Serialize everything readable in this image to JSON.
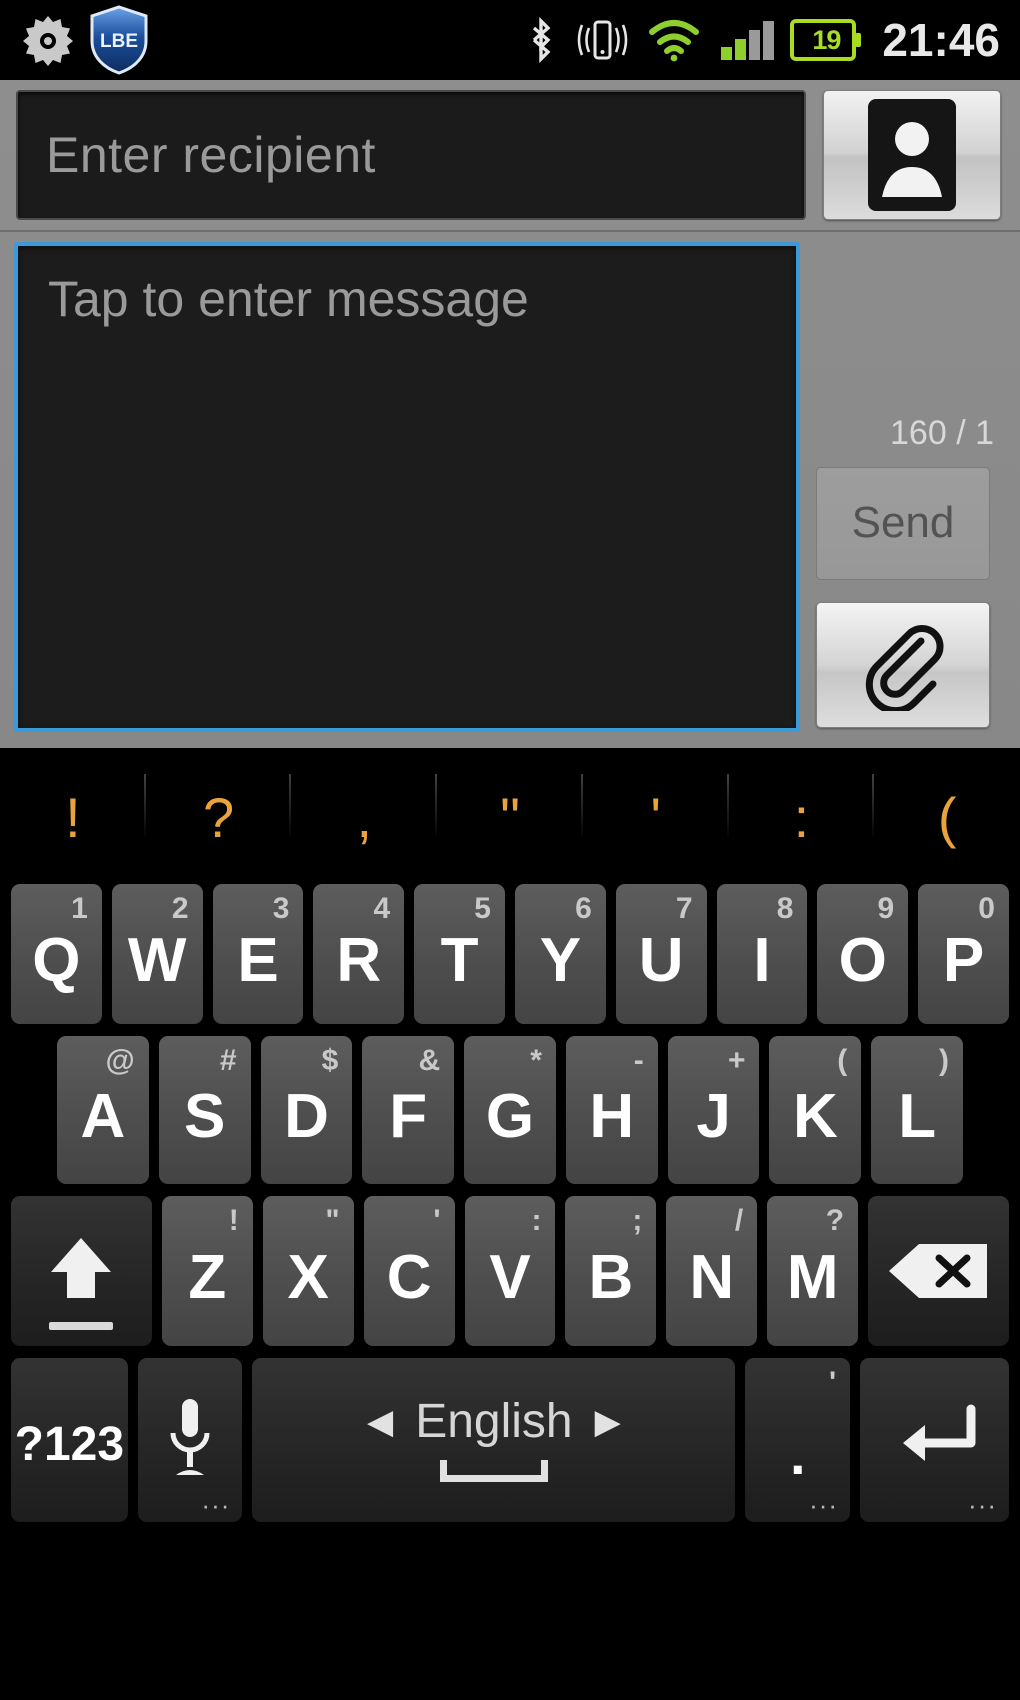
{
  "statusbar": {
    "left_icons": [
      {
        "name": "settings-gear-icon",
        "label": "gear"
      },
      {
        "name": "lbe-security-shield-icon",
        "label": "LBE"
      }
    ],
    "lbe_label": "LBE",
    "right_icons": [
      {
        "name": "bluetooth-icon",
        "label": "bluetooth"
      },
      {
        "name": "vibrate-mode-icon",
        "label": "vibrate"
      },
      {
        "name": "wifi-icon",
        "label": "wifi"
      },
      {
        "name": "cellular-signal-icon",
        "label": "signal"
      }
    ],
    "battery_level": "19",
    "time": "21:46"
  },
  "compose": {
    "recipient": {
      "value": "",
      "placeholder": "Enter recipient"
    },
    "contacts_button_icon": "contact-person-icon",
    "message": {
      "value": "",
      "placeholder": "Tap to enter message"
    },
    "char_counter": "160 / 1",
    "send_label": "Send",
    "attach_button_icon": "paperclip-icon"
  },
  "keyboard": {
    "symbol_strip": [
      "!",
      "?",
      ",",
      "\"",
      "'",
      ":",
      "("
    ],
    "row1": [
      {
        "key": "Q",
        "sup": "1"
      },
      {
        "key": "W",
        "sup": "2"
      },
      {
        "key": "E",
        "sup": "3"
      },
      {
        "key": "R",
        "sup": "4"
      },
      {
        "key": "T",
        "sup": "5"
      },
      {
        "key": "Y",
        "sup": "6"
      },
      {
        "key": "U",
        "sup": "7"
      },
      {
        "key": "I",
        "sup": "8"
      },
      {
        "key": "O",
        "sup": "9"
      },
      {
        "key": "P",
        "sup": "0"
      }
    ],
    "row2": [
      {
        "key": "A",
        "sup": "@"
      },
      {
        "key": "S",
        "sup": "#"
      },
      {
        "key": "D",
        "sup": "$"
      },
      {
        "key": "F",
        "sup": "&"
      },
      {
        "key": "G",
        "sup": "*"
      },
      {
        "key": "H",
        "sup": "-"
      },
      {
        "key": "J",
        "sup": "+"
      },
      {
        "key": "K",
        "sup": "("
      },
      {
        "key": "L",
        "sup": ")"
      }
    ],
    "row3": [
      {
        "key": "Z",
        "sup": "!"
      },
      {
        "key": "X",
        "sup": "\""
      },
      {
        "key": "C",
        "sup": "'"
      },
      {
        "key": "V",
        "sup": ":"
      },
      {
        "key": "B",
        "sup": ";"
      },
      {
        "key": "N",
        "sup": "/"
      },
      {
        "key": "M",
        "sup": "?"
      }
    ],
    "shift_icon": "shift-arrow-icon",
    "backspace_icon": "backspace-icon",
    "symbols_key_label": "?123",
    "mic_icon": "microphone-icon",
    "space_language": "English",
    "space_prev_arrow": "◀",
    "space_next_arrow": "▶",
    "period_key_label": ".",
    "period_key_sup": "'",
    "enter_icon": "enter-return-icon",
    "long_press_hint": "···"
  },
  "colors": {
    "accent_focus": "#3d9ad8",
    "symbol_strip_text": "#e8a33d",
    "battery_green": "#aadd22",
    "panel_gray": "#8c8c8c",
    "key_gray": "#4e4e4e"
  }
}
